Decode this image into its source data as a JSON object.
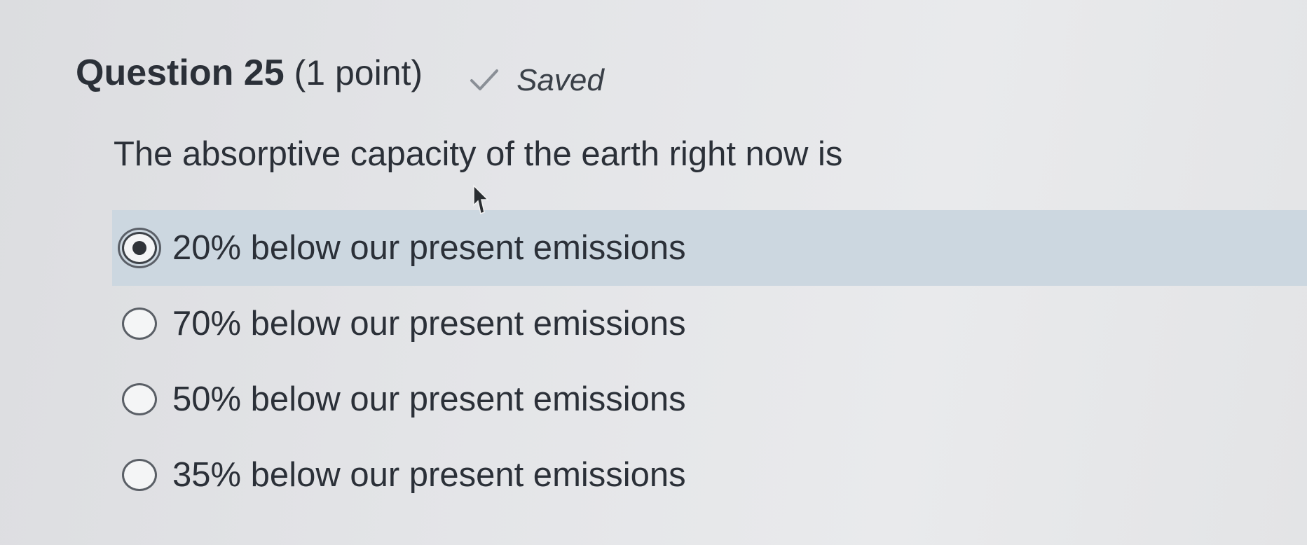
{
  "question": {
    "title": "Question 25",
    "points": "(1 point)",
    "status": "Saved",
    "status_icon": "check-icon",
    "prompt": "The absorptive capacity of the earth right now is"
  },
  "answers": [
    {
      "label": "20% below our present emissions",
      "selected": true
    },
    {
      "label": "70% below our present emissions",
      "selected": false
    },
    {
      "label": "50% below our present emissions",
      "selected": false
    },
    {
      "label": "35% below our present emissions",
      "selected": false
    }
  ],
  "colors": {
    "selected_row": "#ccd7e0",
    "text": "#2b3038"
  }
}
